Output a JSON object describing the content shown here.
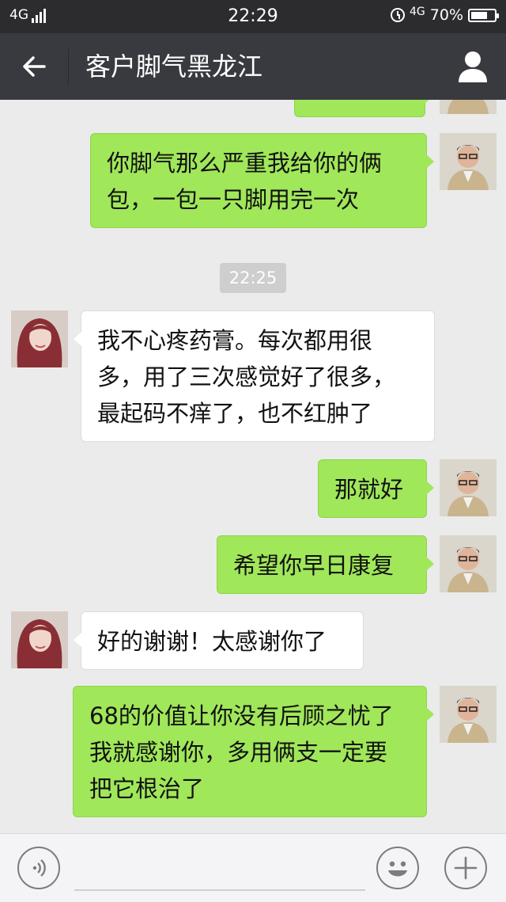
{
  "status_bar": {
    "network_left": "4G",
    "time": "22:29",
    "network_right": "4G",
    "battery_percent": "70%",
    "battery_level": 0.7
  },
  "nav": {
    "title": "客户脚气黑龙江",
    "icons": [
      "back-arrow-icon",
      "person-icon"
    ]
  },
  "chat": {
    "timestamp": "22:25",
    "messages": [
      {
        "side": "out",
        "text": "你脚气那么严重我给你的俩\n包，一包一只脚用完一次"
      },
      {
        "side": "in",
        "text": "我不心疼药膏。每次都用很\n多，用了三次感觉好了很多，\n最起码不痒了，也不红肿了"
      },
      {
        "side": "out",
        "text": "那就好"
      },
      {
        "side": "out",
        "text": "希望你早日康复"
      },
      {
        "side": "in",
        "text": "好的谢谢！太感谢你了"
      },
      {
        "side": "out",
        "text": "68的价值让你没有后顾之忧了\n我就感谢你，多用俩支一定要\n把它根治了"
      }
    ]
  },
  "input_bar": {
    "icons": [
      "voice-icon",
      "emoji-icon",
      "plus-icon"
    ]
  },
  "colors": {
    "outgoing_bubble": "#a0e75a",
    "incoming_bubble": "#ffffff",
    "nav_bg": "#393a3f",
    "chat_bg": "#ebebeb"
  }
}
